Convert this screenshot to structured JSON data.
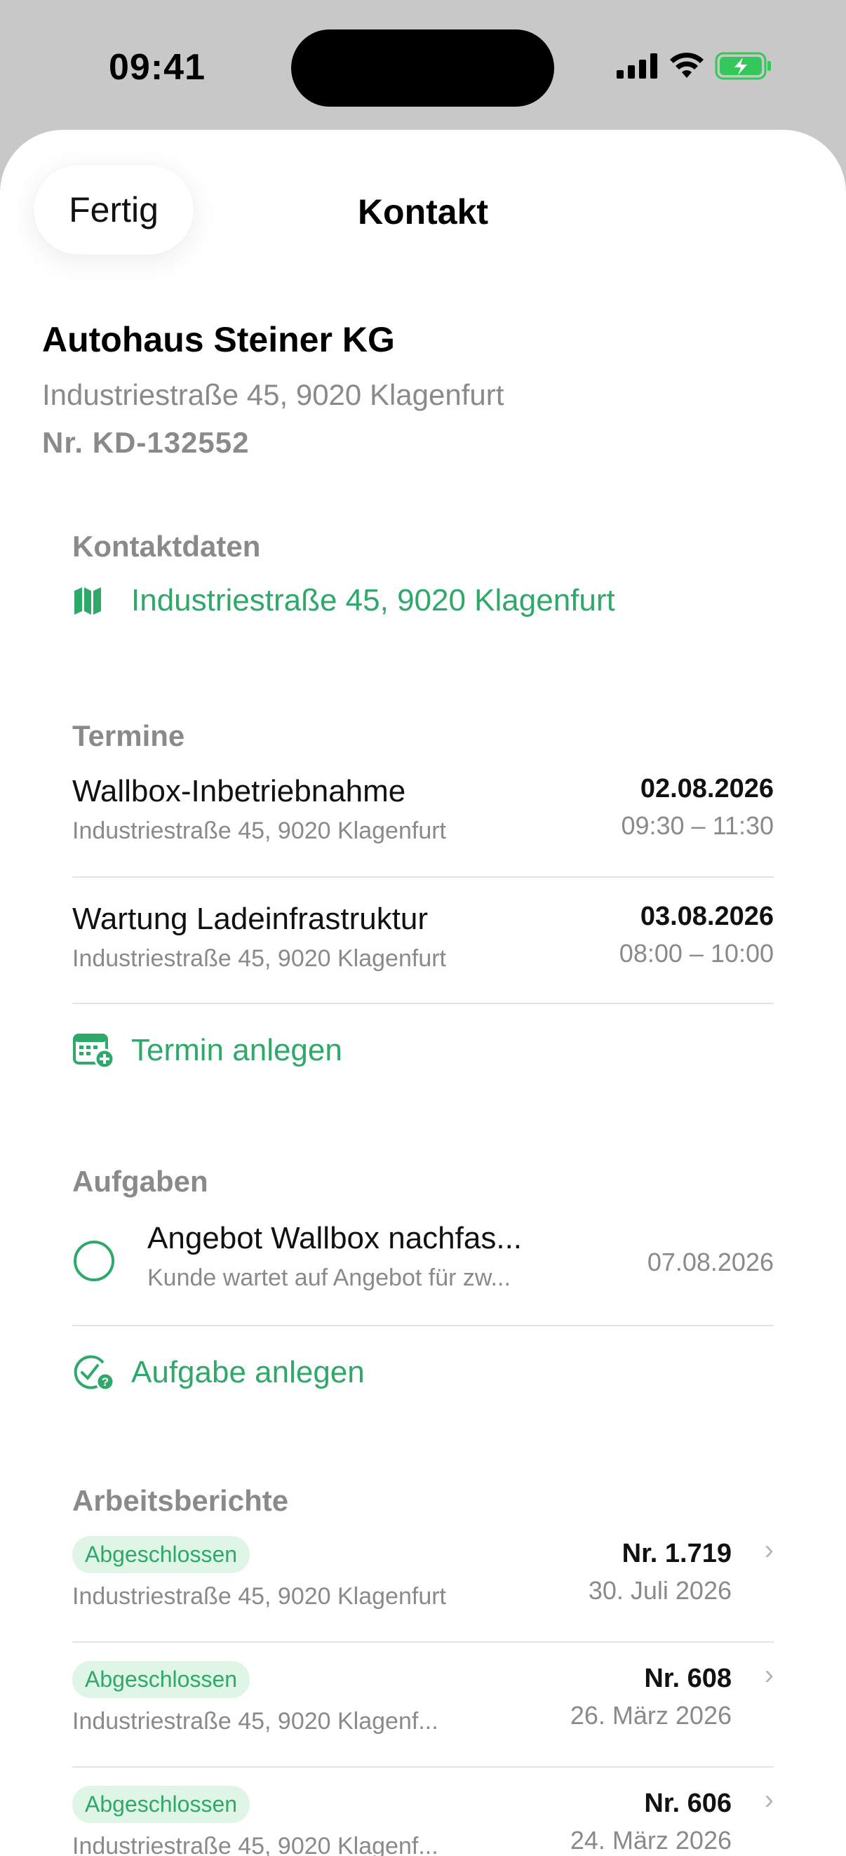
{
  "status": {
    "time": "09:41"
  },
  "nav": {
    "done_label": "Fertig",
    "title": "Kontakt"
  },
  "contact": {
    "name": "Autohaus Steiner KG",
    "address": "Industriestraße 45, 9020 Klagenfurt",
    "number": "Nr. KD-132552"
  },
  "kontaktdaten": {
    "title": "Kontaktdaten",
    "address_link": "Industriestraße 45, 9020 Klagenfurt"
  },
  "termine": {
    "title": "Termine",
    "items": [
      {
        "title": "Wallbox-Inbetriebnahme",
        "address": "Industriestraße 45, 9020 Klagenfurt",
        "date": "02.08.2026",
        "time": "09:30 – 11:30"
      },
      {
        "title": "Wartung Ladeinfrastruktur",
        "address": "Industriestraße 45, 9020 Klagenfurt",
        "date": "03.08.2026",
        "time": "08:00 – 10:00"
      }
    ],
    "add_label": "Termin anlegen"
  },
  "aufgaben": {
    "title": "Aufgaben",
    "items": [
      {
        "title": "Angebot Wallbox nachfas...",
        "subtitle": "Kunde wartet auf Angebot für zw...",
        "date": "07.08.2026"
      }
    ],
    "add_label": "Aufgabe anlegen"
  },
  "berichte": {
    "title": "Arbeitsberichte",
    "items": [
      {
        "status": "Abgeschlossen",
        "address": "Industriestraße 45, 9020 Klagenfurt",
        "number": "Nr. 1.719",
        "date": "30. Juli 2026"
      },
      {
        "status": "Abgeschlossen",
        "address": "Industriestraße 45, 9020 Klagenf...",
        "number": "Nr. 608",
        "date": "26. März 2026"
      },
      {
        "status": "Abgeschlossen",
        "address": "Industriestraße 45, 9020 Klagenf...",
        "number": "Nr. 606",
        "date": "24. März 2026"
      }
    ]
  },
  "colors": {
    "accent": "#2fa96a",
    "badge_bg": "#dff5e6",
    "secondary_text": "#8a8a8a",
    "battery": "#34c759"
  }
}
